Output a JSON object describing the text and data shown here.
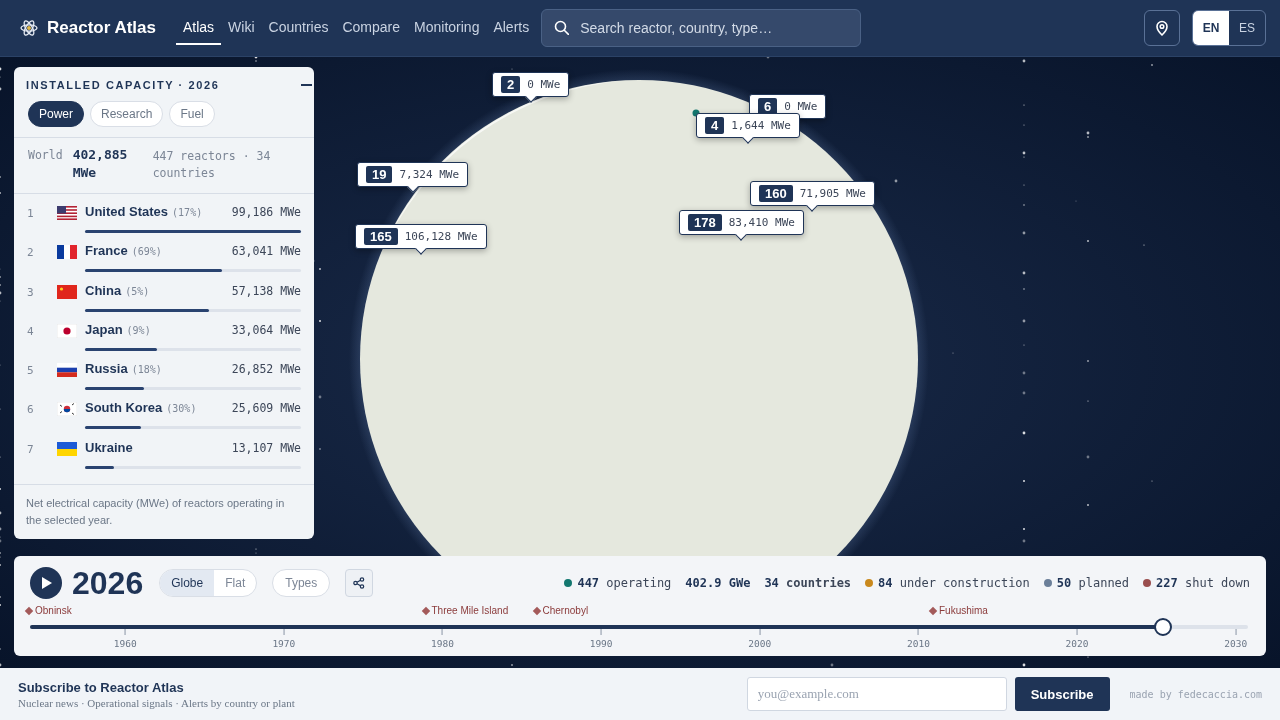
{
  "app": {
    "title": "Reactor Atlas"
  },
  "nav": [
    {
      "label": "Atlas",
      "selected": true
    },
    {
      "label": "Wiki",
      "selected": false
    },
    {
      "label": "Countries",
      "selected": false
    },
    {
      "label": "Compare",
      "selected": false
    },
    {
      "label": "Monitoring",
      "selected": false
    },
    {
      "label": "Alerts",
      "selected": false
    }
  ],
  "search": {
    "placeholder": "Search reactor, country, type…"
  },
  "languages": [
    {
      "label": "EN",
      "selected": true
    },
    {
      "label": "ES",
      "selected": false
    }
  ],
  "capacity_panel": {
    "title": "INSTALLED CAPACITY · 2026",
    "filters": [
      {
        "label": "Power",
        "selected": true
      },
      {
        "label": "Research",
        "selected": false
      },
      {
        "label": "Fuel",
        "selected": false
      }
    ],
    "world": {
      "label": "World",
      "value": "402,885 MWe",
      "summary": "447 reactors · 34 countries"
    },
    "countries": [
      {
        "rank": "1",
        "name": "United States",
        "share": "(17%)",
        "capacity": "99,186 MWe",
        "level": 1
      },
      {
        "rank": "2",
        "name": "France",
        "share": "(69%)",
        "capacity": "63,041 MWe",
        "level": 0.636
      },
      {
        "rank": "3",
        "name": "China",
        "share": "(5%)",
        "capacity": "57,138 MWe",
        "level": 0.576
      },
      {
        "rank": "4",
        "name": "Japan",
        "share": "(9%)",
        "capacity": "33,064 MWe",
        "level": 0.333
      },
      {
        "rank": "5",
        "name": "Russia",
        "share": "(18%)",
        "capacity": "26,852 MWe",
        "level": 0.271
      },
      {
        "rank": "6",
        "name": "South Korea",
        "share": "(30%)",
        "capacity": "25,609 MWe",
        "level": 0.258
      },
      {
        "rank": "7",
        "name": "Ukraine",
        "capacity": "13,107 MWe",
        "level": 0.132
      }
    ],
    "note": "Net electrical capacity (MWe) of reactors operating in the selected year."
  },
  "globe": {
    "markers": [
      {
        "count": "2",
        "capacity": "0 MWe"
      },
      {
        "count": "6",
        "capacity": "0 MWe"
      },
      {
        "count": "4",
        "capacity": "1,644 MWe"
      },
      {
        "count": "19",
        "capacity": "7,324 MWe"
      },
      {
        "count": "160",
        "capacity": "71,905 MWe"
      },
      {
        "count": "165",
        "capacity": "106,128 MWe"
      },
      {
        "count": "178",
        "capacity": "83,410 MWe"
      }
    ]
  },
  "timeline": {
    "year": "2026",
    "views": [
      {
        "label": "Globe",
        "selected": true
      },
      {
        "label": "Flat",
        "selected": false
      }
    ],
    "types_button": "Types",
    "stats": [
      {
        "kind": "dot",
        "text": "**447** operating",
        "color": "#13776f"
      },
      {
        "kind": "plain",
        "text": "**402.9 GWe**"
      },
      {
        "kind": "plain",
        "text": "**34** countries"
      },
      {
        "kind": "dot",
        "text": "**84** under construction",
        "color": "#c9891d"
      },
      {
        "kind": "dot",
        "text": "**50** planned",
        "color": "#6b7f99"
      },
      {
        "kind": "dot",
        "text": "**227** shut down",
        "color": "#9a4e4e"
      }
    ],
    "level": 0.93,
    "events": [
      {
        "label": "Obninsk"
      },
      {
        "label": "Three Mile Island"
      },
      {
        "label": "Chernobyl"
      },
      {
        "label": "Fukushima"
      }
    ],
    "ticks": [
      "1960",
      "1970",
      "1980",
      "1990",
      "2000",
      "2010",
      "2020",
      "2030"
    ]
  },
  "footer": {
    "title": "Subscribe to Reactor Atlas",
    "topics": "Nuclear news · Operational signals · Alerts by country or plant",
    "email_placeholder": "you@example.com",
    "button": "Subscribe",
    "credit": "made by fedecaccia.com"
  }
}
